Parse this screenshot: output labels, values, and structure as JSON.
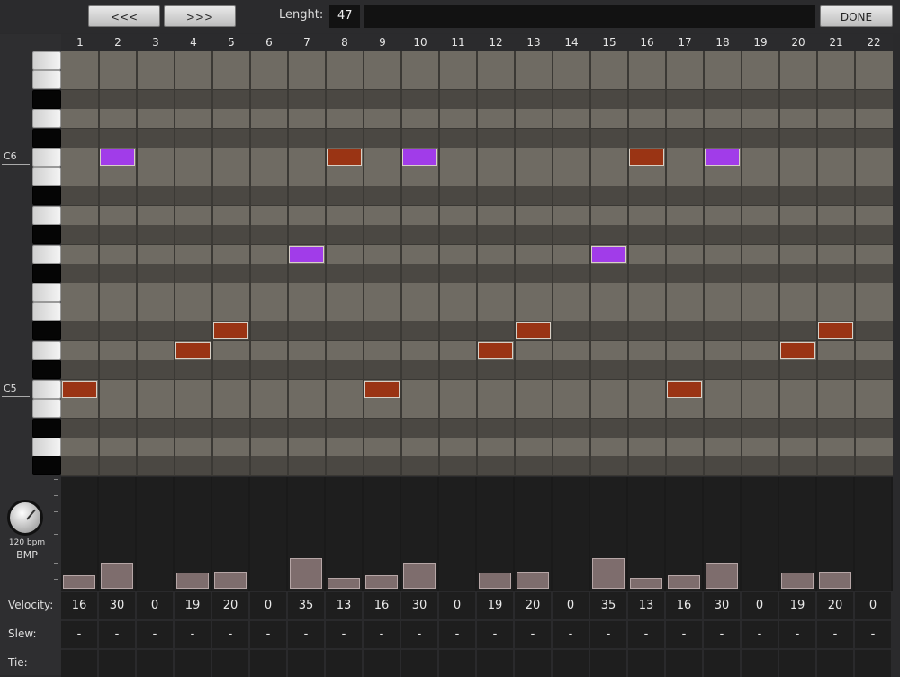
{
  "toolbar": {
    "prev_label": "<<<",
    "next_label": ">>>",
    "length_label": "Lenght:",
    "length_value": "47",
    "done_label": "DONE"
  },
  "columns": [
    "1",
    "2",
    "3",
    "4",
    "5",
    "6",
    "7",
    "8",
    "9",
    "10",
    "11",
    "12",
    "13",
    "14",
    "15",
    "16",
    "17",
    "18",
    "19",
    "20",
    "21",
    "22"
  ],
  "keyboard": {
    "pattern": [
      "white",
      "white",
      "black",
      "white",
      "black",
      "white",
      "white",
      "black",
      "white",
      "black",
      "white",
      "black",
      "white",
      "white",
      "black",
      "white",
      "black",
      "white",
      "white",
      "black",
      "white",
      "black"
    ],
    "labels": [
      {
        "text": "C6",
        "row": 5
      },
      {
        "text": "C5",
        "row": 17
      }
    ]
  },
  "notes": [
    {
      "step": 1,
      "row": 17,
      "color": "#9a3414"
    },
    {
      "step": 2,
      "row": 5,
      "color": "#a13ce9"
    },
    {
      "step": 4,
      "row": 15,
      "color": "#9a3414"
    },
    {
      "step": 5,
      "row": 14,
      "color": "#9a3414"
    },
    {
      "step": 7,
      "row": 10,
      "color": "#a13ce9"
    },
    {
      "step": 8,
      "row": 5,
      "color": "#9a3414"
    },
    {
      "step": 9,
      "row": 17,
      "color": "#9a3414"
    },
    {
      "step": 10,
      "row": 5,
      "color": "#a13ce9"
    },
    {
      "step": 12,
      "row": 15,
      "color": "#9a3414"
    },
    {
      "step": 13,
      "row": 14,
      "color": "#9a3414"
    },
    {
      "step": 15,
      "row": 10,
      "color": "#a13ce9"
    },
    {
      "step": 16,
      "row": 5,
      "color": "#9a3414"
    },
    {
      "step": 17,
      "row": 17,
      "color": "#9a3414"
    },
    {
      "step": 18,
      "row": 5,
      "color": "#a13ce9"
    },
    {
      "step": 20,
      "row": 15,
      "color": "#9a3414"
    },
    {
      "step": 21,
      "row": 14,
      "color": "#9a3414"
    }
  ],
  "tempo": {
    "value": "120 bpm",
    "label": "BMP"
  },
  "rows": {
    "velocity_label": "Velocity:",
    "slew_label": "Slew:",
    "tie_label": "Tie:"
  },
  "velocity": [
    "16",
    "30",
    "0",
    "19",
    "20",
    "0",
    "35",
    "13",
    "16",
    "30",
    "0",
    "19",
    "20",
    "0",
    "35",
    "13",
    "16",
    "30",
    "0",
    "19",
    "20",
    "0"
  ],
  "slew": [
    "-",
    "-",
    "-",
    "-",
    "-",
    "-",
    "-",
    "-",
    "-",
    "-",
    "-",
    "-",
    "-",
    "-",
    "-",
    "-",
    "-",
    "-",
    "-",
    "-",
    "-",
    "-"
  ],
  "tie": [
    "",
    "",
    "",
    "",
    "",
    "",
    "",
    "",
    "",
    "",
    "",
    "",
    "",
    "",
    "",
    "",
    "",
    "",
    "",
    "",
    "",
    ""
  ]
}
